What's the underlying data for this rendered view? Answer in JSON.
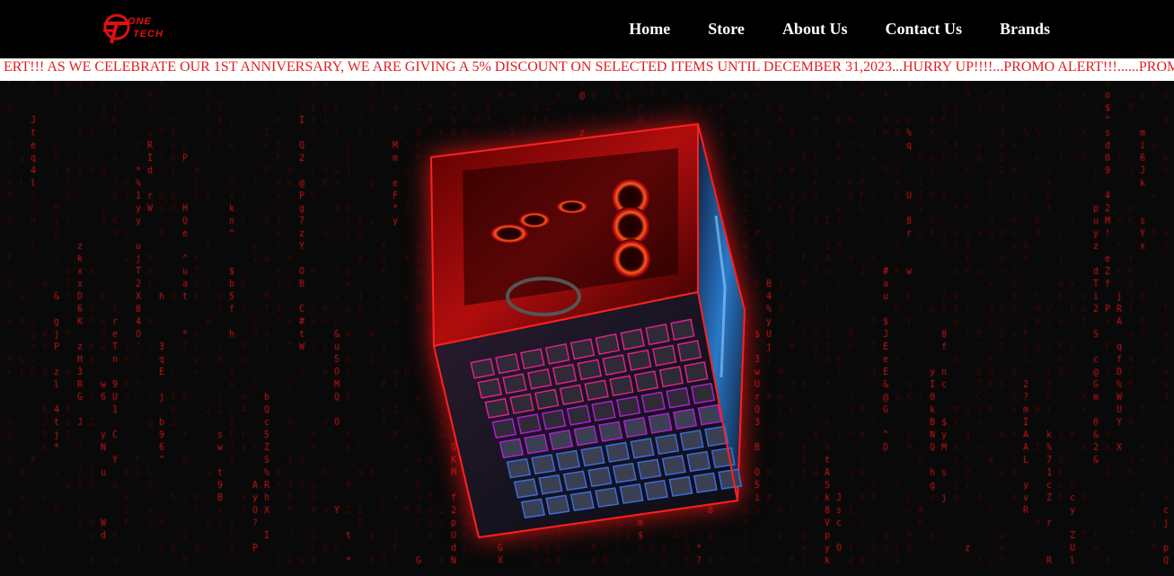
{
  "brand": {
    "line1": "ONE",
    "line2": "TECH",
    "color": "#e01010"
  },
  "nav": {
    "items": [
      "Home",
      "Store",
      "About Us",
      "Contact Us",
      "Brands"
    ]
  },
  "promo": {
    "text": "ERT!!! AS WE CELEBRATE OUR 1ST ANNIVERSARY, WE ARE GIVING A 5% DISCOUNT ON SELECTED ITEMS UNTIL DECEMBER 31,2023...HURRY UP!!!!...PROMO ALERT!!!......PROMO",
    "color": "#e02020"
  },
  "colors": {
    "background": "#090909",
    "rain_bright": "#c81414",
    "rain_dim": "#3a0a0a",
    "glow": "#ff1414"
  },
  "cube": {
    "top_image": "gaming-pc-case-icon",
    "front_image": "rgb-keyboard-icon",
    "side_image": "blue-lit-panel-icon"
  }
}
